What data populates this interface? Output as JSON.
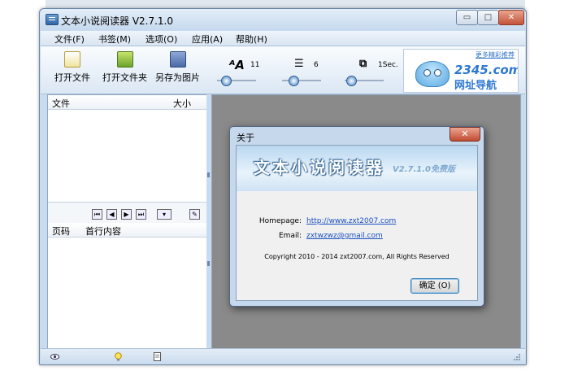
{
  "window": {
    "title": "文本小说阅读器 V2.7.1.0",
    "min_glyph": "▭",
    "max_glyph": "□",
    "close_glyph": "✕"
  },
  "menu": [
    "文件(F)",
    "书签(M)",
    "选项(O)",
    "应用(A)",
    "帮助(H)"
  ],
  "toolbar": {
    "open_file": "打开文件",
    "open_folder": "打开文件夹",
    "save_image": "另存为图片",
    "font_size": "11",
    "line_spacing": "6",
    "scroll_interval": "1Sec."
  },
  "ad": {
    "brand": "2345.com",
    "tagline": "网址导航",
    "top_link": "更多精彩推荐"
  },
  "file_list": {
    "col_file": "文件",
    "col_size": "大小"
  },
  "bookmarks": {
    "col_page": "页码",
    "col_first_line": "首行内容"
  },
  "about_dialog": {
    "title": "关于",
    "app_name": "文本小说阅读器",
    "version": "V2.7.1.0免费版",
    "homepage_label": "Homepage:",
    "homepage_url": "http://www.zxt2007.com",
    "email_label": "Email:",
    "email": "zxtwzwz@gmail.com",
    "copyright": "Copyright 2010 - 2014 zxt2007.com, All Rights Reserved",
    "ok_button": "确定 (O)"
  },
  "colors": {
    "window_frame": "#c9dcef",
    "reading_area": "#8a8a8a",
    "link": "#1a4fc2",
    "ad_blue": "#2d78d1"
  }
}
